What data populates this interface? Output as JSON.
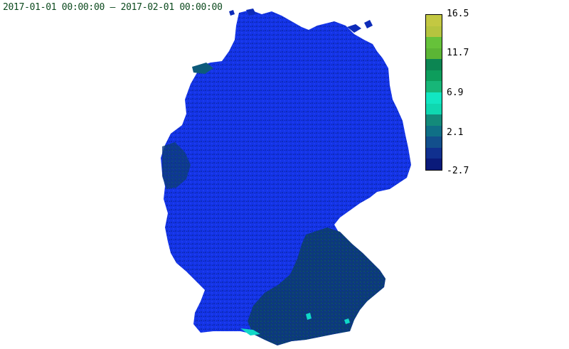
{
  "title": "2017-01-01 00:00:00 – 2017-02-01 00:00:00",
  "legend": {
    "ticks": [
      "16.5",
      "11.7",
      "6.9",
      "2.1",
      "-2.7"
    ],
    "colors": [
      "#0a1a7a",
      "#10308f",
      "#124f8c",
      "#0f6f86",
      "#138a7a",
      "#0fd7b0",
      "#12e6c2",
      "#17b678",
      "#0d9d5c",
      "#0c8552",
      "#5bb535",
      "#66c23a",
      "#b5c43f",
      "#c3c842"
    ]
  },
  "map_colors": {
    "deep_blue": "#1a2fe0",
    "mid_blue": "#1040d8",
    "dark_navy": "#0a1f9a",
    "teal_dark": "#0d4a6a",
    "cyan": "#10d8c8"
  }
}
